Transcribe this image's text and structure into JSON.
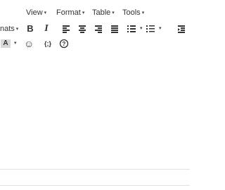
{
  "menubar": {
    "view_label": "View",
    "format_label": "Format",
    "table_label": "Table",
    "tools_label": "Tools",
    "caret": "▾"
  },
  "toolbar": {
    "formats_label": "nats",
    "caret": "▾",
    "bold_label": "B",
    "italic_label": "I",
    "bg_color_label": "A",
    "emoticons_glyph": "☺",
    "code_sample_label": "{;}",
    "help_glyph": "?"
  },
  "colors": {
    "icon": "#333333",
    "background": "#ffffff",
    "border": "#e2e2e2",
    "highlight_box": "#d8d8d8"
  }
}
